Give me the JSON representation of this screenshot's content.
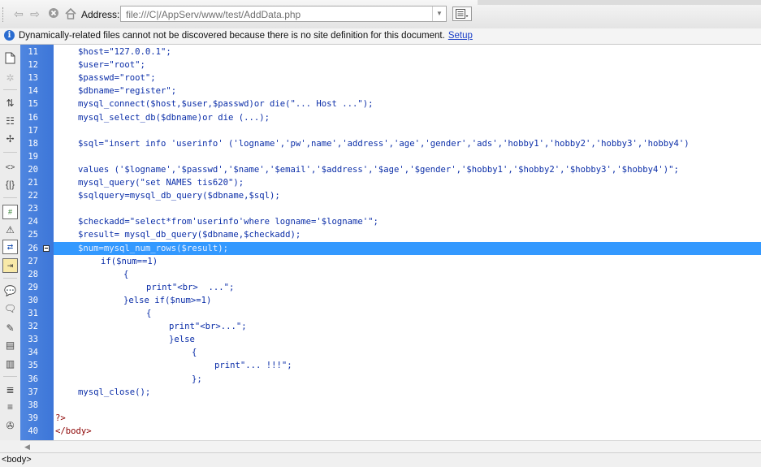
{
  "address_bar": {
    "label": "Address:",
    "url": "file:///C|/AppServ/www/test/AddData.php",
    "icons": [
      "back-arrow-icon",
      "forward-arrow-icon",
      "stop-icon",
      "home-icon",
      "browse-list-icon"
    ]
  },
  "info_bar": {
    "message": "Dynamically-related files cannot not be discovered because there is no site definition for this document.",
    "link": "Setup"
  },
  "editor": {
    "lines": [
      {
        "n": "11",
        "text": "$host=\"127.0.0.1\";",
        "indent": 1
      },
      {
        "n": "12",
        "text": "$user=\"root\";",
        "indent": 1
      },
      {
        "n": "13",
        "text": "$passwd=\"root\";",
        "indent": 1
      },
      {
        "n": "14",
        "text": "$dbname=\"register\";",
        "indent": 1
      },
      {
        "n": "15",
        "text": "mysql_connect($host,$user,$passwd)or die(\"... Host ...\");",
        "indent": 1
      },
      {
        "n": "16",
        "text": "mysql_select_db($dbname)or die (...);",
        "indent": 1
      },
      {
        "n": "17",
        "text": "",
        "indent": 0
      },
      {
        "n": "18",
        "text": "$sql=\"insert info 'userinfo' ('logname','pw',name','address','age','gender','ads','hobby1','hobby2','hobby3','hobby4')",
        "indent": 1
      },
      {
        "n": "19",
        "text": "",
        "indent": 0
      },
      {
        "n": "20",
        "text": "values ('$logname','$passwd','$name','$email','$address','$age','$gender','$hobby1','$hobby2','$hobby3','$hobby4')\";",
        "indent": 1
      },
      {
        "n": "21",
        "text": "mysql_query(\"set NAMES tis620\");",
        "indent": 1
      },
      {
        "n": "22",
        "text": "$sqlquery=mysql_db_query($dbname,$sql);",
        "indent": 1
      },
      {
        "n": "23",
        "text": "",
        "indent": 0
      },
      {
        "n": "24",
        "text": "$checkadd=\"select*from'userinfo'where logname='$logname'\";",
        "indent": 1
      },
      {
        "n": "25",
        "text": "$result= mysql_db_query($dbname,$checkadd);",
        "indent": 1
      },
      {
        "n": "26",
        "text": "$num=mysql_num_rows($result);",
        "indent": 1
      },
      {
        "n": "27",
        "text": "if($num==1)",
        "indent": 2
      },
      {
        "n": "28",
        "text": "{",
        "indent": 3
      },
      {
        "n": "29",
        "text": "print\"<br>  ...\";",
        "indent": 4
      },
      {
        "n": "30",
        "text": "}else if($num>=1)",
        "indent": 3
      },
      {
        "n": "31",
        "text": "{",
        "indent": 4
      },
      {
        "n": "32",
        "text": "print\"<br>...\";",
        "indent": 5
      },
      {
        "n": "33",
        "text": "}else",
        "indent": 5
      },
      {
        "n": "34",
        "text": "{",
        "indent": 6
      },
      {
        "n": "35",
        "text": "print\"... !!!\";",
        "indent": 7
      },
      {
        "n": "36",
        "text": "};",
        "indent": 6
      },
      {
        "n": "37",
        "text": "mysql_close();",
        "indent": 1
      },
      {
        "n": "38",
        "text": "",
        "indent": 0
      },
      {
        "n": "39",
        "text": "?>",
        "indent": 0
      },
      {
        "n": "40",
        "text": "</body>",
        "indent": 0
      }
    ],
    "selected_line": "26"
  },
  "status_bar": {
    "tag_selector": "<body>"
  },
  "toolbar_icons": [
    "open-documents-icon",
    "file-management-icon",
    "collapse-full-tag-icon",
    "collapse-selection-icon",
    "expand-all-icon",
    "select-parent-tag-icon",
    "balance-braces-icon",
    "line-numbers-icon",
    "highlight-invalid-code-icon",
    "syntax-coloring-icon",
    "auto-indent-icon",
    "apply-comment-icon",
    "remove-comment-icon",
    "wrap-tag-icon",
    "recent-snippets-icon",
    "move-css-icon",
    "indent-code-icon",
    "outdent-code-icon",
    "format-source-code-icon"
  ],
  "colors": {
    "gutter": "#4f86e0",
    "selection": "#3399ff",
    "code_text": "#0b2ea8",
    "tag_text": "#8b0000",
    "link": "#1a3ec8"
  }
}
